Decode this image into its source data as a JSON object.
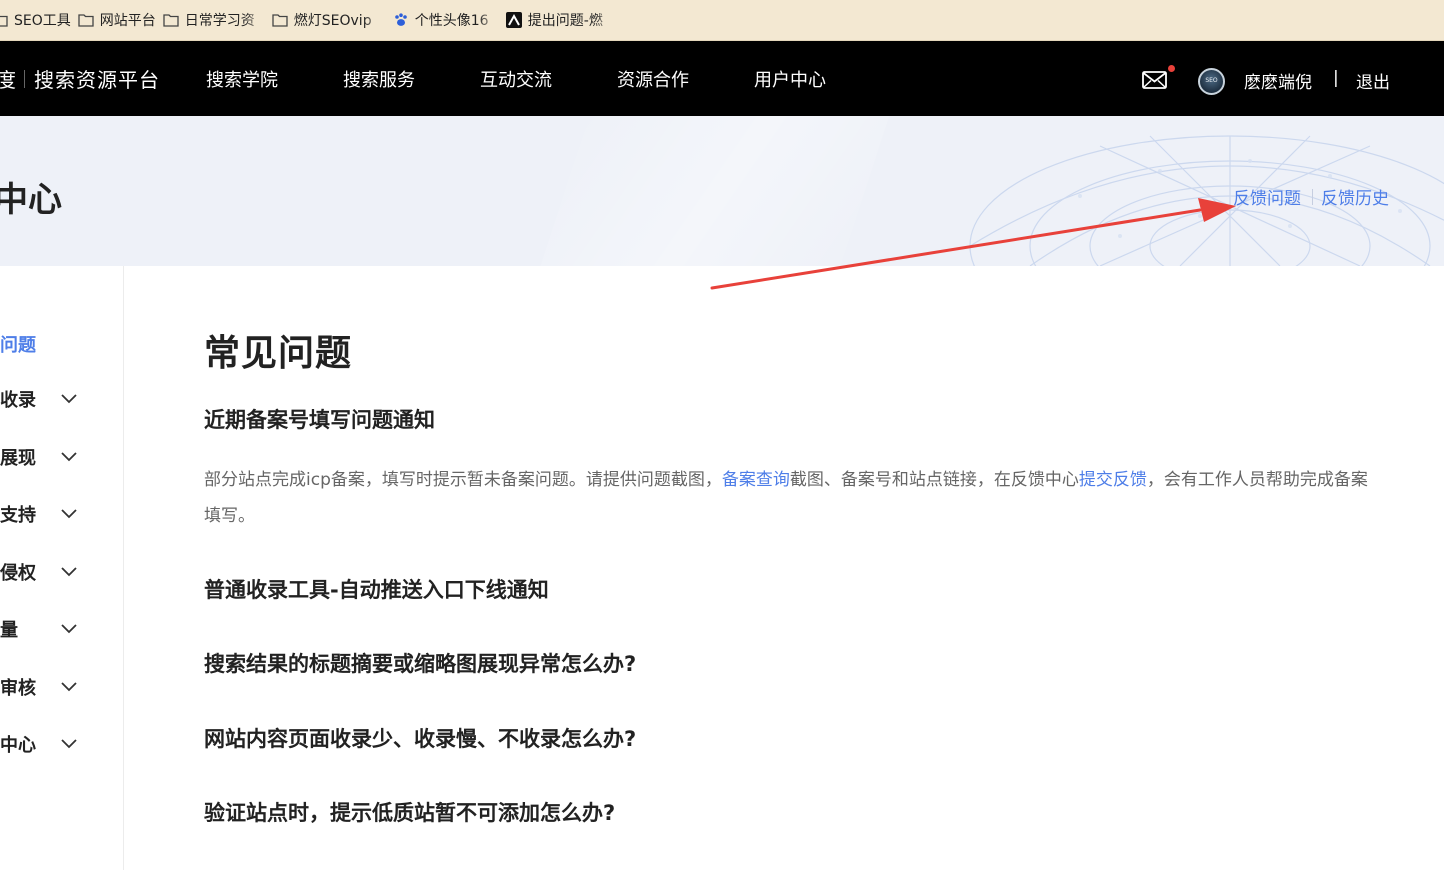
{
  "bookmarks": [
    {
      "label": "SEO工具",
      "icon": "folder-icon"
    },
    {
      "label": "网站平台",
      "icon": "folder-icon"
    },
    {
      "label": "日常学习资",
      "icon": "folder-icon"
    },
    {
      "label": "燃灯SEOvip",
      "icon": "folder-icon"
    },
    {
      "label": "个性头像16",
      "icon": "baidu-paw-icon"
    },
    {
      "label": "提出问题-燃",
      "icon": "site-favicon-icon"
    }
  ],
  "nav": {
    "brand_left": "度",
    "brand_name": "搜索资源平台",
    "items": [
      "搜索学院",
      "搜索服务",
      "互动交流",
      "资源合作",
      "用户中心"
    ],
    "avatar_text": "SEO",
    "username": "麽麽端倪",
    "separator": "|",
    "logout": "退出"
  },
  "banner": {
    "title": "中心",
    "link_feedback": "反馈问题",
    "link_history": "反馈历史"
  },
  "sidebar": {
    "items": [
      {
        "label": "问题",
        "active": true,
        "has_chevron": false
      },
      {
        "label": "收录",
        "active": false,
        "has_chevron": true
      },
      {
        "label": "展现",
        "active": false,
        "has_chevron": true
      },
      {
        "label": "支持",
        "active": false,
        "has_chevron": true
      },
      {
        "label": "侵权",
        "active": false,
        "has_chevron": true
      },
      {
        "label": "量",
        "active": false,
        "has_chevron": true
      },
      {
        "label": "审核",
        "active": false,
        "has_chevron": true
      },
      {
        "label": "中心",
        "active": false,
        "has_chevron": true
      }
    ]
  },
  "main": {
    "title": "常见问题",
    "faq": [
      {
        "question": "近期备案号填写问题通知",
        "body": {
          "part1": "部分站点完成icp备案，填写时提示暂未备案问题。请提供问题截图，",
          "link1": "备案查询",
          "part2": "截图、备案号和站点链接，在反馈中心",
          "link2": "提交反馈",
          "part3": "，会有工作人员帮助完成备案填写。"
        }
      },
      {
        "question": "普通收录工具-自动推送入口下线通知"
      },
      {
        "question": "搜索结果的标题摘要或缩略图展现异常怎么办?"
      },
      {
        "question": "网站内容页面收录少、收录慢、不收录怎么办?"
      },
      {
        "question": "验证站点时，提示低质站暂不可添加怎么办?"
      }
    ]
  },
  "colors": {
    "accent_blue": "#4e7ee8",
    "nav_bg": "#000000",
    "banner_bg": "#eef1f8",
    "bookmarks_bg": "#f3e8d2",
    "annotation_red": "#e8413a"
  }
}
